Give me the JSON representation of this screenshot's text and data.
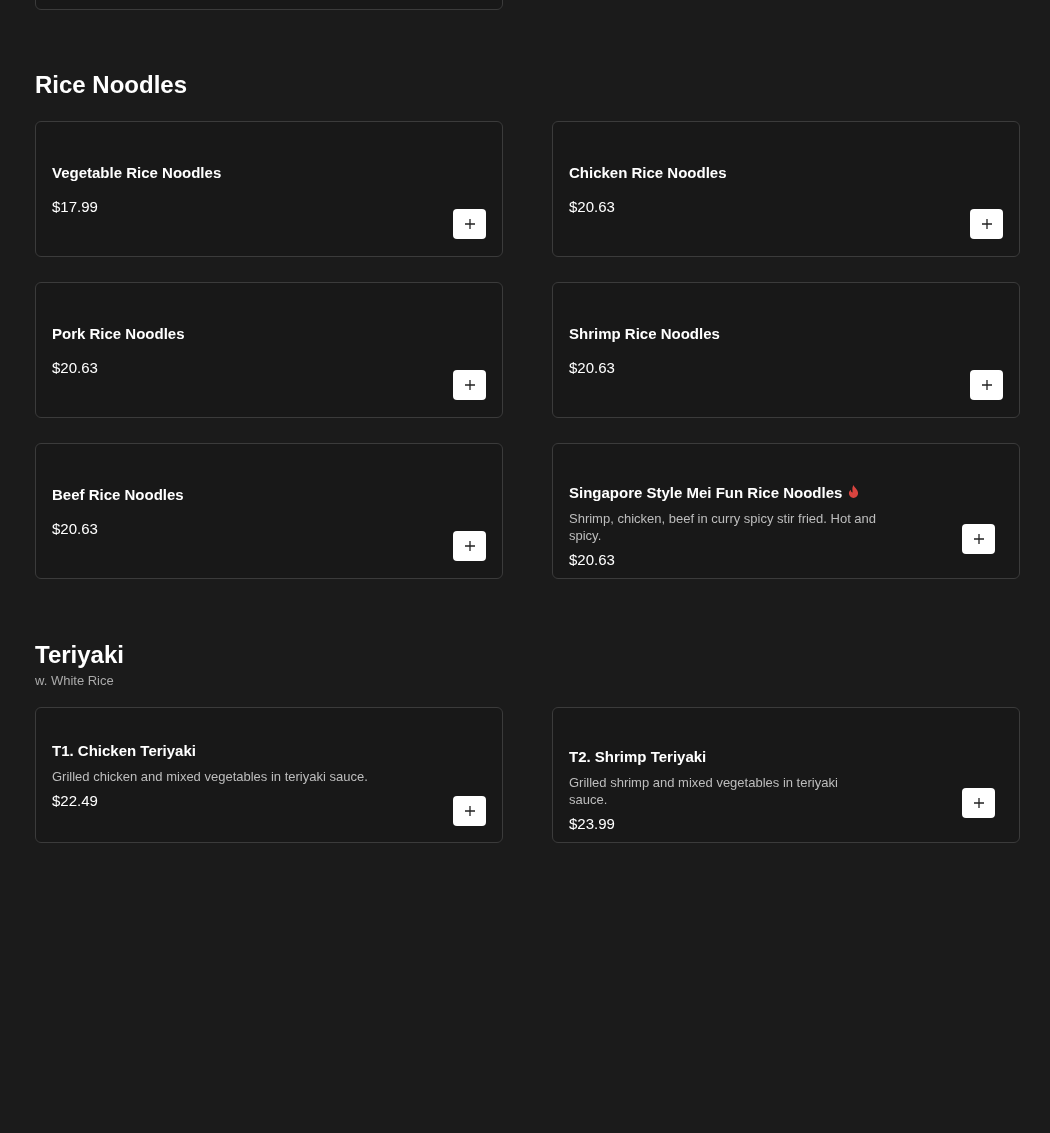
{
  "sections": [
    {
      "title": "Rice Noodles",
      "items": [
        {
          "name": "Vegetable Rice Noodles",
          "price": "$17.99",
          "spicy": false
        },
        {
          "name": "Chicken Rice Noodles",
          "price": "$20.63",
          "spicy": false
        },
        {
          "name": "Pork Rice Noodles",
          "price": "$20.63",
          "spicy": false
        },
        {
          "name": "Shrimp Rice Noodles",
          "price": "$20.63",
          "spicy": false
        },
        {
          "name": "Beef Rice Noodles",
          "price": "$20.63",
          "spicy": false
        },
        {
          "name": "Singapore Style Mei Fun Rice Noodles",
          "description": "Shrimp, chicken, beef in curry spicy stir fried. Hot and spicy.",
          "price": "$20.63",
          "spicy": true
        }
      ]
    },
    {
      "title": "Teriyaki",
      "subtitle": "w. White Rice",
      "items": [
        {
          "name": "T1. Chicken Teriyaki",
          "description": "Grilled chicken and mixed vegetables in teriyaki sauce.",
          "price": "$22.49",
          "spicy": false
        },
        {
          "name": "T2. Shrimp Teriyaki",
          "description": "Grilled shrimp and mixed vegetables in teriyaki sauce.",
          "price": "$23.99",
          "spicy": false
        }
      ]
    }
  ]
}
